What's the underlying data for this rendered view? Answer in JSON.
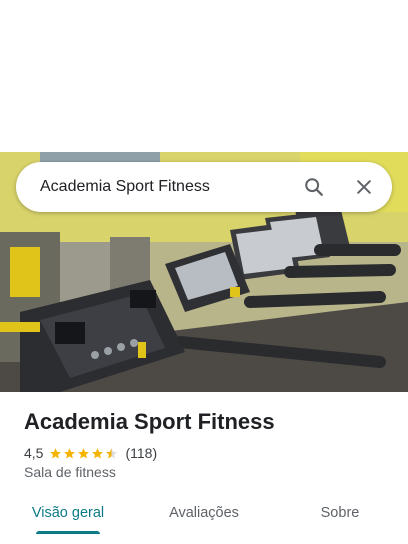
{
  "search": {
    "query": "Academia Sport Fitness"
  },
  "icons": {
    "search": "search-icon",
    "close": "close-icon",
    "star": "star-icon"
  },
  "place": {
    "name": "Academia Sport Fitness",
    "rating": "4,5",
    "rating_stars": 4.5,
    "review_count": "(118)",
    "category": "Sala de fitness"
  },
  "tabs": [
    {
      "label": "Visão geral",
      "active": true
    },
    {
      "label": "Avaliações",
      "active": false
    },
    {
      "label": "Sobre",
      "active": false
    }
  ],
  "colors": {
    "accent": "#0b7b86",
    "star": "#f4b400"
  }
}
